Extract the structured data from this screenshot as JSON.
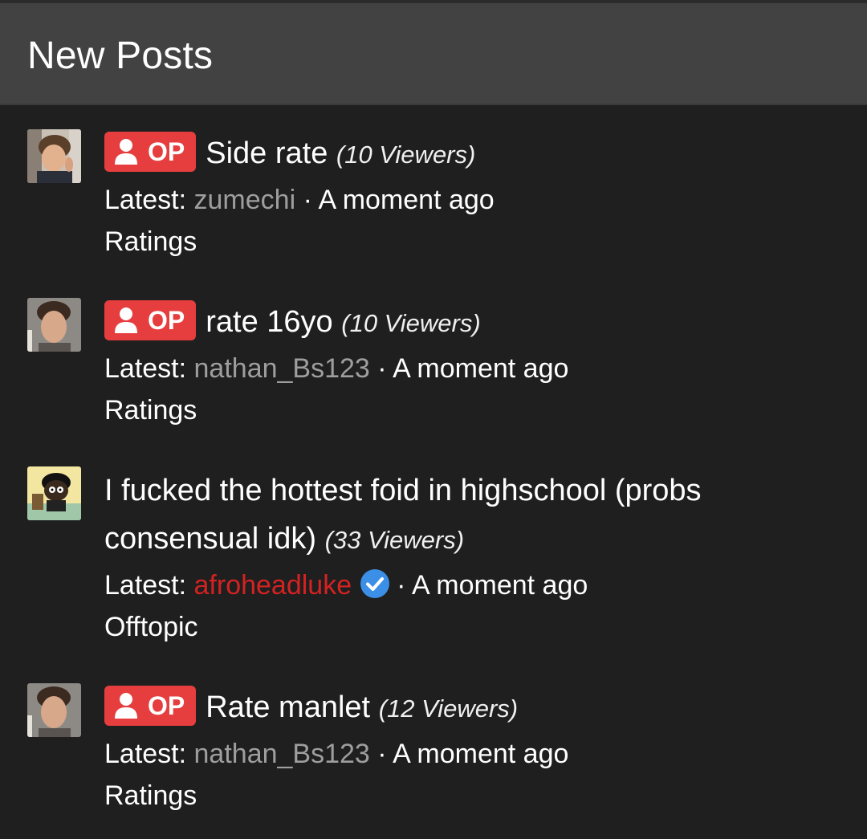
{
  "header": {
    "title": "New Posts"
  },
  "posts": [
    {
      "op_badge": "OP",
      "title": "Side rate",
      "viewers": "(10 Viewers)",
      "latest_label": "Latest: ",
      "latest_user": "zumechi",
      "separator": " · ",
      "time": "A moment ago",
      "category": "Ratings"
    },
    {
      "op_badge": "OP",
      "title": "rate 16yo",
      "viewers": "(10 Viewers)",
      "latest_label": "Latest: ",
      "latest_user": "nathan_Bs123",
      "separator": " · ",
      "time": "A moment ago",
      "category": "Ratings"
    },
    {
      "title": "I fucked the hottest foid in highschool (probs consensual idk)",
      "viewers": "(33 Viewers)",
      "latest_label": "Latest: ",
      "latest_user": "afroheadluke",
      "separator": "· ",
      "time": "A moment ago",
      "category": "Offtopic"
    },
    {
      "op_badge": "OP",
      "title": "Rate manlet",
      "viewers": "(12 Viewers)",
      "latest_label": "Latest: ",
      "latest_user": "nathan_Bs123",
      "separator": " · ",
      "time": "A moment ago",
      "category": "Ratings"
    }
  ],
  "colors": {
    "background": "#1f1f1f",
    "header": "#424242",
    "op_badge": "#e63e3e",
    "username_gray": "#9e9e9e",
    "username_red": "#d32222",
    "verified_blue": "#3b8fe6"
  },
  "icons": {
    "op": "user-icon",
    "verified": "verified-check-icon"
  }
}
